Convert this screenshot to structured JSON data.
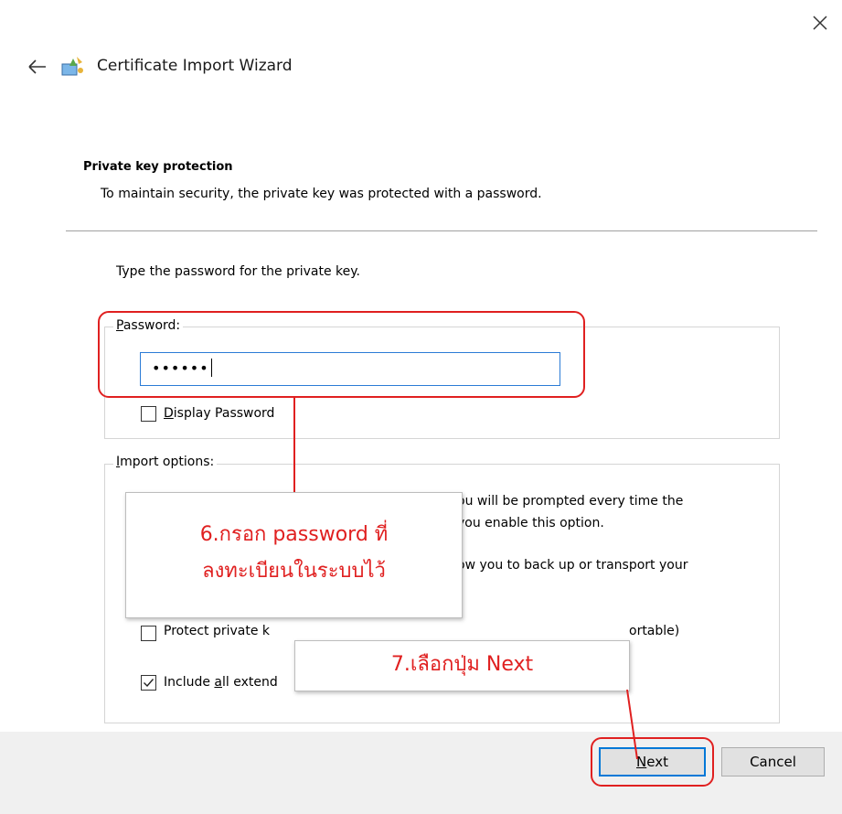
{
  "window": {
    "title": "Certificate Import Wizard",
    "close_icon": "close-icon",
    "back_icon": "back-arrow-icon",
    "app_icon": "certificate-wizard-icon"
  },
  "header": {
    "heading": "Private key protection",
    "description": "To maintain security, the private key was protected with a password."
  },
  "body": {
    "prompt": "Type the password for the private key."
  },
  "password_group": {
    "legend_first": "P",
    "legend_rest": "assword:",
    "value": "••••••",
    "display_password": {
      "label_first": "D",
      "label_rest": "isplay Password",
      "checked": false
    }
  },
  "import_options": {
    "legend_first": "I",
    "legend_rest": "mport options:",
    "option1_text_line1": "ou will be prompted every time the",
    "option1_text_line2": "you enable this option.",
    "option2_text": "ow you to back up or transport your",
    "protect_label_visible": "Protect private k",
    "protect_label_tail": "ortable)",
    "protect_checked": false,
    "include_label_before": "Include ",
    "include_label_mnemonic": "a",
    "include_label_after": "ll extend",
    "include_checked": true
  },
  "callouts": {
    "step6_line1": "6.กรอก password ที่",
    "step6_line2": "ลงทะเบียนในระบบไว้",
    "step7": "7.เลือกปุ่ม Next"
  },
  "footer": {
    "next_first": "N",
    "next_rest": "ext",
    "cancel": "Cancel"
  },
  "colors": {
    "accent_blue": "#0078d7",
    "callout_red": "#e02020",
    "footer_bg": "#f0f0f0"
  }
}
